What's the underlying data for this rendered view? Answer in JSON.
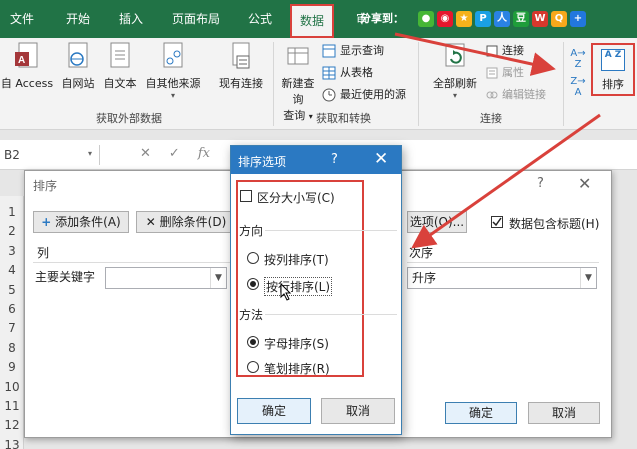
{
  "tabs": {
    "file": "文件",
    "home": "开始",
    "insert": "插入",
    "layout": "页面布局",
    "formulas": "公式",
    "data": "数据",
    "review": "审"
  },
  "share": {
    "label": "分享到：",
    "icons": [
      "wechat-icon",
      "weibo-icon",
      "qzone-icon",
      "qq-icon",
      "douban-icon",
      "renren-icon",
      "more-icon"
    ]
  },
  "ribbon": {
    "get_external_data": {
      "group_label": "获取外部数据",
      "from_access": "自 Access",
      "from_web": "自网站",
      "from_text": "自文本",
      "from_other": "自其他来源",
      "existing": "现有连接"
    },
    "get_transform": {
      "group_label": "获取和转换",
      "new_query": "新建查询",
      "new_query_2": "查询",
      "show_queries": "显示查询",
      "from_table": "从表格",
      "recent_sources": "最近使用的源"
    },
    "connections": {
      "group_label": "连接",
      "refresh_all": "全部刷新",
      "connections": "连接",
      "properties": "属性",
      "edit_links": "编辑链接"
    },
    "sort": {
      "sort_label": "排序",
      "sort_az": "A→Z",
      "sort_za": "Z→A",
      "sort_icon_text": "A Z"
    }
  },
  "formula_bar": {
    "name_box": "B2",
    "cancel": "✕",
    "enter": "✓",
    "fx": "fx"
  },
  "rows": [
    "1",
    "2",
    "3",
    "4",
    "5",
    "6",
    "7",
    "8",
    "9",
    "10",
    "11",
    "12",
    "13"
  ],
  "sort_dialog": {
    "title": "排序",
    "add_condition": "添加条件(A)",
    "delete_condition": "删除条件(D)",
    "options": "选项(O)...",
    "has_headers": "数据包含标题(H)",
    "col_header": "列",
    "order_header": "次序",
    "primary_key_label": "主要关键字",
    "primary_key_value": "",
    "order_value": "升序",
    "ok": "确定",
    "cancel": "取消",
    "help": "?",
    "close": "✕"
  },
  "options_dialog": {
    "title": "排序选项",
    "help": "?",
    "close": "✕",
    "case_sensitive": "区分大小写(C)",
    "direction_label": "方向",
    "by_column": "按列排序(T)",
    "by_row": "按行排序(L)",
    "method_label": "方法",
    "alphabetic": "字母排序(S)",
    "stroke": "笔划排序(R)",
    "ok": "确定",
    "cancel": "取消"
  },
  "colors": {
    "accent": "#217346",
    "highlight": "#d9413b",
    "titlebar": "#2b79c2"
  }
}
